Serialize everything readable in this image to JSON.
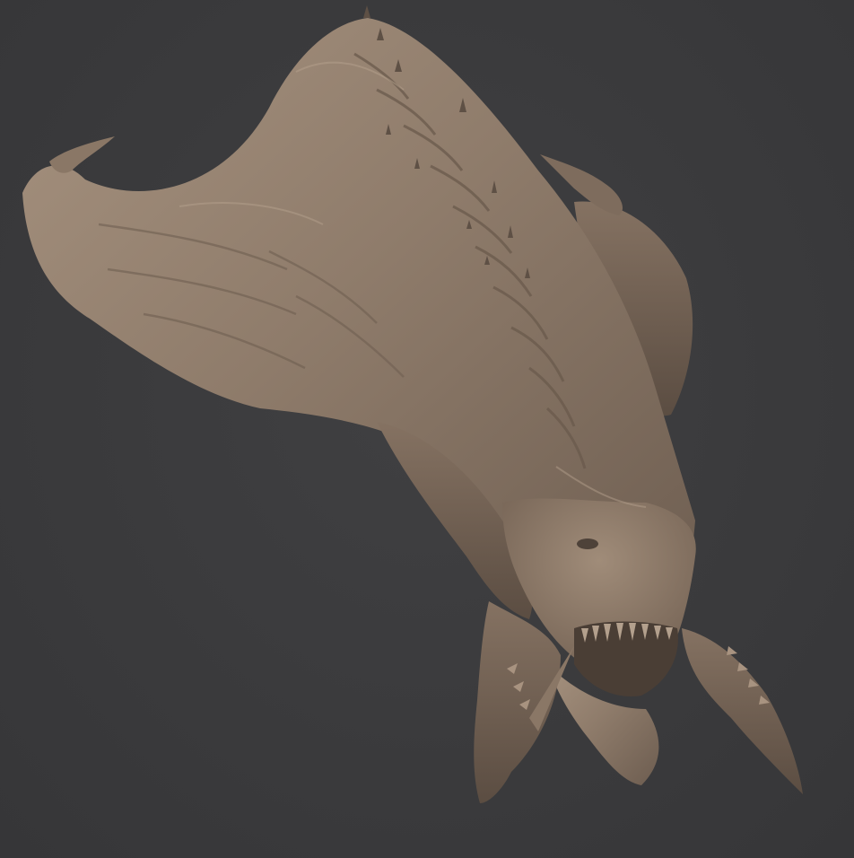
{
  "scene": {
    "background_color": "#3b3b3d",
    "material_color": "#8c7a6b",
    "subject": "creature-head-sculpt"
  }
}
